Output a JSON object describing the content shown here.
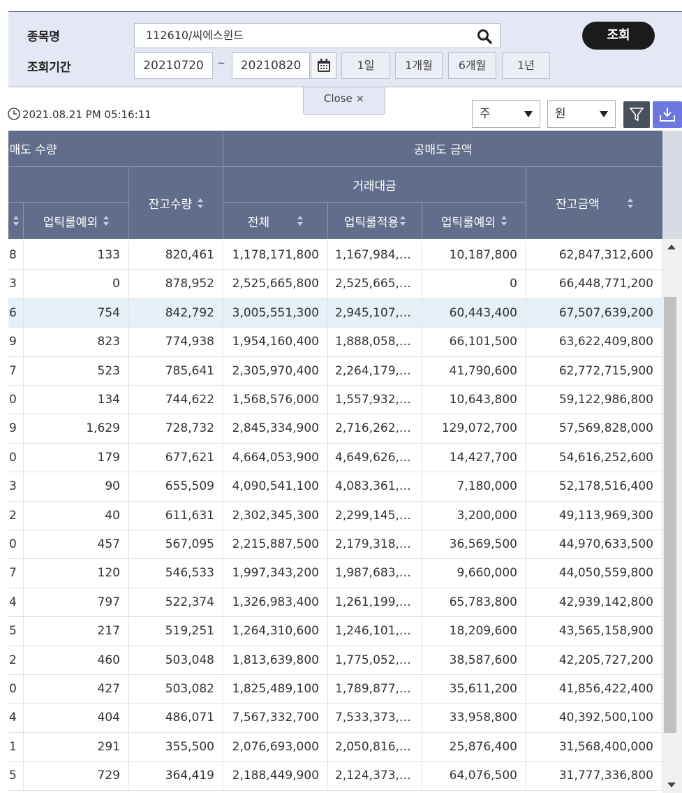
{
  "search": {
    "stock_label": "종목명",
    "stock_value": "112610/씨에스윈드",
    "period_label": "조회기간",
    "date_from": "20210720",
    "date_separator": "~",
    "date_to": "20210820",
    "query_button": "조회",
    "period_buttons": [
      "1일",
      "1개월",
      "6개월",
      "1년"
    ]
  },
  "close_tab": "Close ×",
  "toolbar": {
    "timestamp": "2021.08.21 PM 05:16:11",
    "unit_select_1": "주",
    "unit_select_2": "원"
  },
  "colors": {
    "panel_bg": "#e4e7f4",
    "header_bg": "#616d8b",
    "selected_row": "#e5f1f7",
    "download_button": "#6c78e0",
    "filter_button": "#4a4f5c"
  },
  "grid": {
    "header": {
      "short_qty_group": "공매도 수량",
      "short_qty_group_visible": "공매도 수량",
      "short_amt_group": "공매도 금액",
      "trade_amt_group": "거래대금",
      "balance_qty": "잔고수량",
      "balance_amt": "잔고금액",
      "uptick_exempt": "업틱룰예외",
      "total": "전체",
      "uptick_applied": "업틱룰적용",
      "uptick_exempt_amt": "업틱룰예외",
      "partial_left": ""
    },
    "rows": [
      {
        "c0": "8",
        "c1": "133",
        "c2": "820,461",
        "c3": "1,178,171,800",
        "c4": "1,167,984,…",
        "c5": "10,187,800",
        "c6": "62,847,312,600"
      },
      {
        "c0": "3",
        "c1": "0",
        "c2": "878,952",
        "c3": "2,525,665,800",
        "c4": "2,525,665,…",
        "c5": "0",
        "c6": "66,448,771,200"
      },
      {
        "c0": "6",
        "c1": "754",
        "c2": "842,792",
        "c3": "3,005,551,300",
        "c4": "2,945,107,…",
        "c5": "60,443,400",
        "c6": "67,507,639,200"
      },
      {
        "c0": "9",
        "c1": "823",
        "c2": "774,938",
        "c3": "1,954,160,400",
        "c4": "1,888,058,…",
        "c5": "66,101,500",
        "c6": "63,622,409,800"
      },
      {
        "c0": "7",
        "c1": "523",
        "c2": "785,641",
        "c3": "2,305,970,400",
        "c4": "2,264,179,…",
        "c5": "41,790,600",
        "c6": "62,772,715,900"
      },
      {
        "c0": "0",
        "c1": "134",
        "c2": "744,622",
        "c3": "1,568,576,000",
        "c4": "1,557,932,…",
        "c5": "10,643,800",
        "c6": "59,122,986,800"
      },
      {
        "c0": "9",
        "c1": "1,629",
        "c2": "728,732",
        "c3": "2,845,334,900",
        "c4": "2,716,262,…",
        "c5": "129,072,700",
        "c6": "57,569,828,000"
      },
      {
        "c0": "0",
        "c1": "179",
        "c2": "677,621",
        "c3": "4,664,053,900",
        "c4": "4,649,626,…",
        "c5": "14,427,700",
        "c6": "54,616,252,600"
      },
      {
        "c0": "3",
        "c1": "90",
        "c2": "655,509",
        "c3": "4,090,541,100",
        "c4": "4,083,361,…",
        "c5": "7,180,000",
        "c6": "52,178,516,400"
      },
      {
        "c0": "2",
        "c1": "40",
        "c2": "611,631",
        "c3": "2,302,345,300",
        "c4": "2,299,145,…",
        "c5": "3,200,000",
        "c6": "49,113,969,300"
      },
      {
        "c0": "0",
        "c1": "457",
        "c2": "567,095",
        "c3": "2,215,887,500",
        "c4": "2,179,318,…",
        "c5": "36,569,500",
        "c6": "44,970,633,500"
      },
      {
        "c0": "7",
        "c1": "120",
        "c2": "546,533",
        "c3": "1,997,343,200",
        "c4": "1,987,683,…",
        "c5": "9,660,000",
        "c6": "44,050,559,800"
      },
      {
        "c0": "4",
        "c1": "797",
        "c2": "522,374",
        "c3": "1,326,983,400",
        "c4": "1,261,199,…",
        "c5": "65,783,800",
        "c6": "42,939,142,800"
      },
      {
        "c0": "5",
        "c1": "217",
        "c2": "519,251",
        "c3": "1,264,310,600",
        "c4": "1,246,101,…",
        "c5": "18,209,600",
        "c6": "43,565,158,900"
      },
      {
        "c0": "2",
        "c1": "460",
        "c2": "503,048",
        "c3": "1,813,639,800",
        "c4": "1,775,052,…",
        "c5": "38,587,600",
        "c6": "42,205,727,200"
      },
      {
        "c0": "0",
        "c1": "427",
        "c2": "503,082",
        "c3": "1,825,489,100",
        "c4": "1,789,877,…",
        "c5": "35,611,200",
        "c6": "41,856,422,400"
      },
      {
        "c0": "4",
        "c1": "404",
        "c2": "486,071",
        "c3": "7,567,332,700",
        "c4": "7,533,373,…",
        "c5": "33,958,800",
        "c6": "40,392,500,100"
      },
      {
        "c0": "1",
        "c1": "291",
        "c2": "355,500",
        "c3": "2,076,693,000",
        "c4": "2,050,816,…",
        "c5": "25,876,400",
        "c6": "31,568,400,000"
      },
      {
        "c0": "5",
        "c1": "729",
        "c2": "364,419",
        "c3": "2,188,449,900",
        "c4": "2,124,373,…",
        "c5": "64,076,500",
        "c6": "31,777,336,800"
      }
    ],
    "selected_row_index": 2
  }
}
